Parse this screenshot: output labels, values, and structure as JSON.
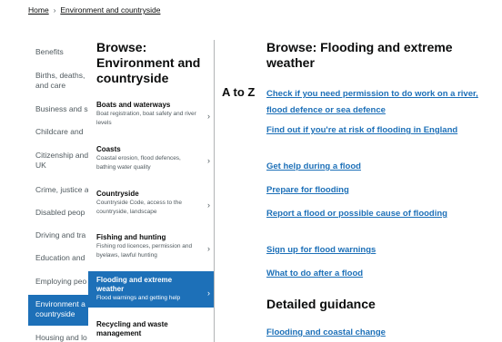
{
  "breadcrumb": {
    "home": "Home",
    "separator": "›",
    "current": "Environment and countryside"
  },
  "col1": {
    "items": [
      {
        "label": "Benefits"
      },
      {
        "label": "Births, deaths,",
        "label2": "and care"
      },
      {
        "label": "Business and s"
      },
      {
        "label": "Childcare and"
      },
      {
        "label": "Citizenship and",
        "label2": "UK"
      },
      {
        "label": "Crime, justice a"
      },
      {
        "label": "Disabled peop"
      },
      {
        "label": "Driving and tra"
      },
      {
        "label": "Education and"
      },
      {
        "label": "Employing peo"
      },
      {
        "label": "Environment a",
        "label2": "countryside"
      },
      {
        "label": "Housing and lo"
      }
    ]
  },
  "col2": {
    "title": "Browse: Environment and countryside",
    "chevron": "›",
    "items": [
      {
        "title": "Boats and waterways",
        "desc": "Boat registration, boat safety and river levels"
      },
      {
        "title": "Coasts",
        "desc": "Coastal erosion, flood defences, bathing water quality"
      },
      {
        "title": "Countryside",
        "desc": "Countryside Code, access to the countryside, landscape"
      },
      {
        "title": "Fishing and hunting",
        "desc": "Fishing rod licences, permission and byelaws, lawful hunting"
      },
      {
        "title": "Flooding and extreme weather",
        "desc": "Flood warnings and getting help"
      },
      {
        "title": "Recycling and waste management",
        "desc": ""
      }
    ]
  },
  "atoz": "A to Z",
  "main": {
    "title": "Browse: Flooding and extreme weather",
    "links": [
      "Check if you need permission to do work on a river, flood defence or sea defence",
      "Find out if you're at risk of flooding in England",
      "Get help during a flood",
      "Prepare for flooding",
      "Report a flood or possible cause of flooding",
      "Sign up for flood warnings",
      "What to do after a flood"
    ],
    "detailed_heading": "Detailed guidance",
    "detailed_link": "Flooding and coastal change"
  },
  "colors": {
    "link": "#1d70b8",
    "active_bg": "#1d70b8",
    "text": "#0b0c0c",
    "secondary": "#505a5f"
  }
}
